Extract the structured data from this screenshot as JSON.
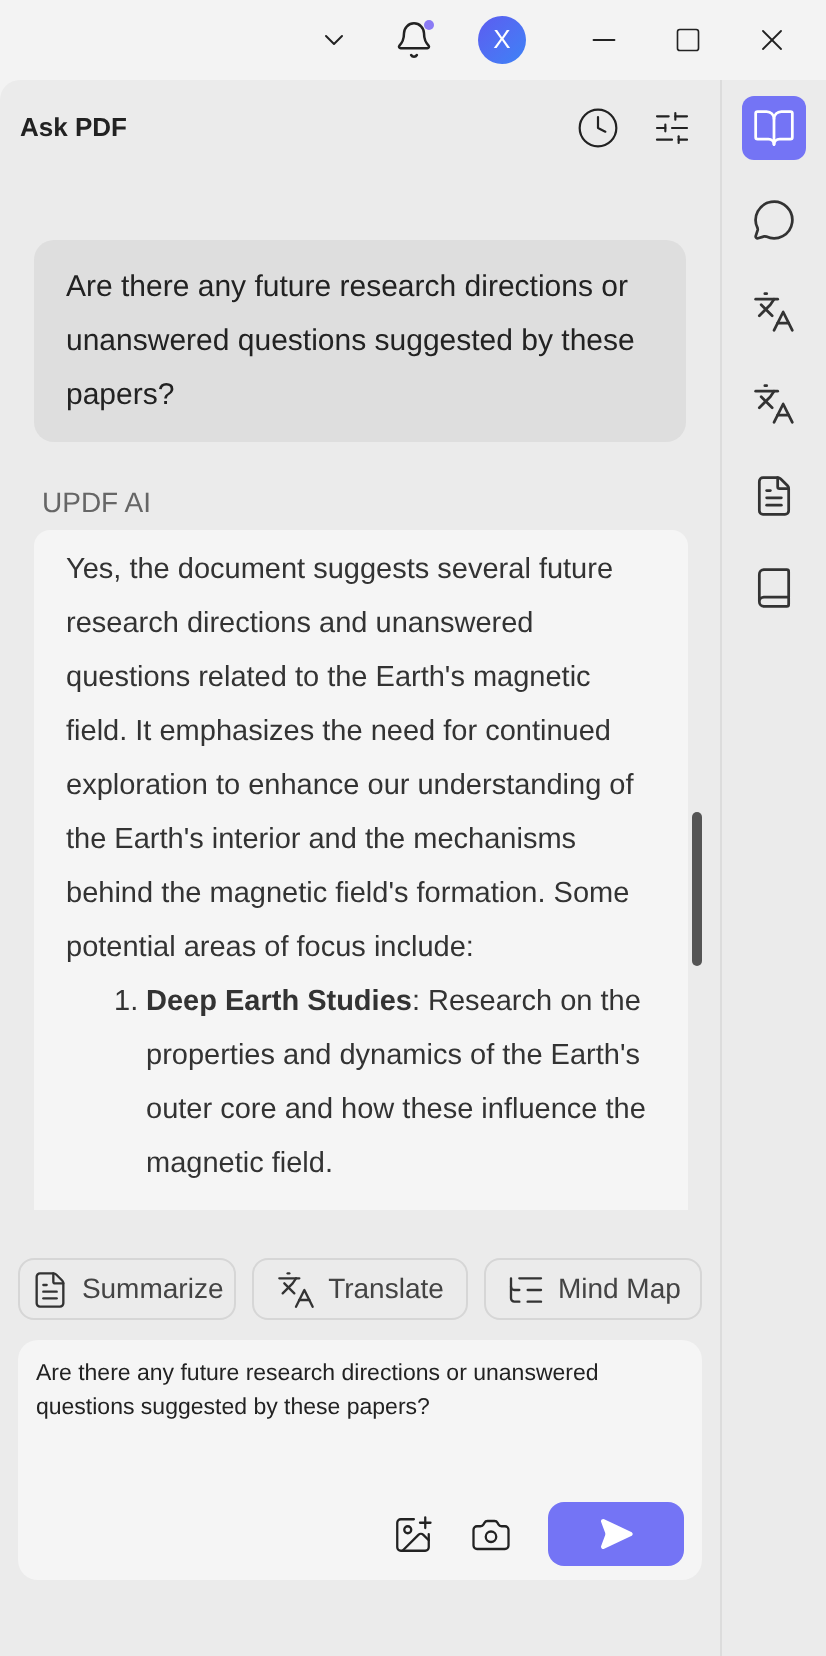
{
  "title_bar": {
    "avatar_letter": "X",
    "notification_unread": true
  },
  "panel": {
    "title": "Ask PDF"
  },
  "question": "Are there any future research directions or unanswered questions suggested by these papers?",
  "answer": {
    "sender": "UPDF AI",
    "paragraph": "Yes, the document suggests several future research directions and unanswered questions related to the Earth's magnetic field. It emphasizes the need for continued exploration to enhance our understanding of the Earth's interior and the mechanisms behind the magnetic field's formation. Some potential areas of focus include:",
    "list": [
      {
        "number": "1.",
        "text": "**Deep Earth Studies**: Research on the properties and dynamics of the Earth's outer core and how these influence the magnetic field."
      }
    ]
  },
  "quick_actions": [
    {
      "kind": "summarize",
      "label": "Summarize"
    },
    {
      "kind": "translate",
      "label": "Translate"
    },
    {
      "kind": "mindmap",
      "label": "Mind Map"
    }
  ],
  "input": {
    "value": "Are there any future research directions or unanswered questions suggested by these papers?"
  },
  "sidebar": [
    {
      "kind": "askpdf",
      "selected": true
    },
    {
      "kind": "chat",
      "selected": false
    },
    {
      "kind": "translate",
      "selected": false
    },
    {
      "kind": "explain",
      "selected": false
    },
    {
      "kind": "summarize",
      "selected": false
    },
    {
      "kind": "book",
      "selected": false
    }
  ]
}
